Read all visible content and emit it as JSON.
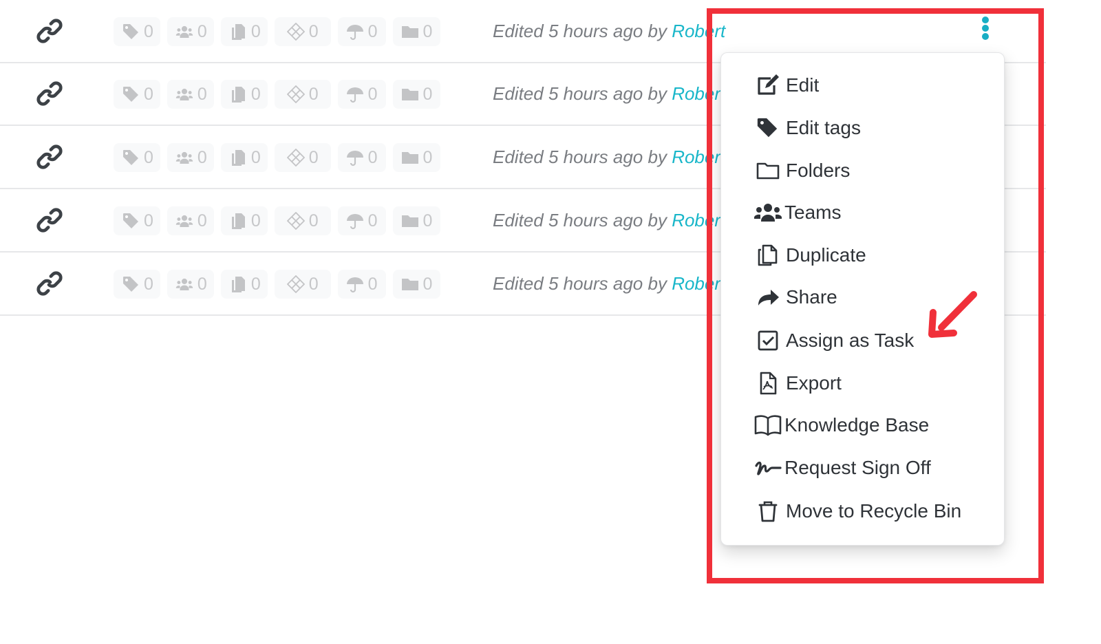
{
  "rows": [
    {
      "badges": {
        "tags": "0",
        "teams": "0",
        "documents": "0",
        "risks": "0",
        "policies": "0",
        "folders": "0"
      },
      "edited_prefix": "Edited 5 hours ago by ",
      "author": "Robert"
    },
    {
      "badges": {
        "tags": "0",
        "teams": "0",
        "documents": "0",
        "risks": "0",
        "policies": "0",
        "folders": "0"
      },
      "edited_prefix": "Edited 5 hours ago by ",
      "author": "Robert"
    },
    {
      "badges": {
        "tags": "0",
        "teams": "0",
        "documents": "0",
        "risks": "0",
        "policies": "0",
        "folders": "0"
      },
      "edited_prefix": "Edited 5 hours ago by ",
      "author": "Robert"
    },
    {
      "badges": {
        "tags": "0",
        "teams": "0",
        "documents": "0",
        "risks": "0",
        "policies": "0",
        "folders": "0"
      },
      "edited_prefix": "Edited 5 hours ago by ",
      "author": "Robert"
    },
    {
      "badges": {
        "tags": "0",
        "teams": "0",
        "documents": "0",
        "risks": "0",
        "policies": "0",
        "folders": "0"
      },
      "edited_prefix": "Edited 5 hours ago by ",
      "author": "Robert"
    }
  ],
  "row_icon": "link-icon",
  "badge_icons": [
    "tag-icon",
    "users-icon",
    "copy-icon",
    "diamond-grid-icon",
    "umbrella-icon",
    "folder-icon"
  ],
  "context_menu": {
    "items": [
      {
        "label": "Edit",
        "icon": "edit-icon"
      },
      {
        "label": "Edit tags",
        "icon": "tag-icon"
      },
      {
        "label": "Folders",
        "icon": "folder-icon"
      },
      {
        "label": "Teams",
        "icon": "users-icon"
      },
      {
        "label": "Duplicate",
        "icon": "copy-icon"
      },
      {
        "label": "Share",
        "icon": "share-icon"
      },
      {
        "label": "Assign as Task",
        "icon": "checkbox-icon"
      },
      {
        "label": "Export",
        "icon": "file-pdf-icon"
      },
      {
        "label": "Knowledge Base",
        "icon": "book-icon"
      },
      {
        "label": "Request Sign Off",
        "icon": "signature-icon"
      },
      {
        "label": "Move to Recycle Bin",
        "icon": "trash-icon"
      }
    ]
  },
  "colors": {
    "accent": "#18b6c9",
    "annotation": "#f0303a",
    "menu_text": "#2f3338",
    "muted_text": "#7a7d82",
    "badge_icon": "#c3c4c6"
  },
  "annotation": {
    "highlighted_item": "Assign as Task"
  }
}
